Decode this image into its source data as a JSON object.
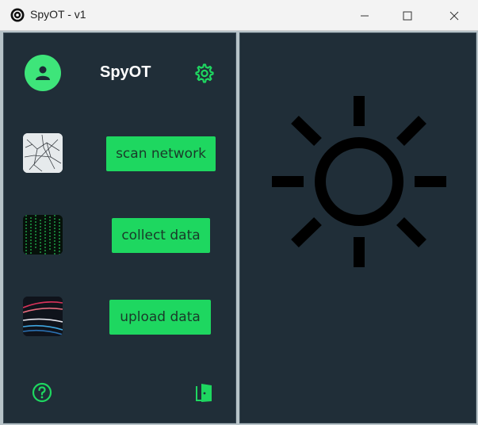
{
  "window": {
    "title": "SpyOT - v1",
    "icon": "app-logo-icon",
    "controls": [
      "minimize-icon",
      "maximize-icon",
      "close-icon"
    ]
  },
  "sidebar": {
    "app_name": "SpyOT",
    "avatar_icon": "user-icon",
    "settings_icon": "gear-icon",
    "actions": [
      {
        "label": "scan network",
        "thumbnail": "cracked-glass-image"
      },
      {
        "label": "collect data",
        "thumbnail": "matrix-code-image"
      },
      {
        "label": "upload data",
        "thumbnail": "light-streaks-image"
      }
    ],
    "help_icon": "help-icon",
    "exit_icon": "exit-door-icon"
  },
  "main": {
    "theme_icon": "sun-icon"
  },
  "colors": {
    "accent": "#1ed760",
    "panel": "#202e38",
    "text_on_accent": "#1a3a2a"
  }
}
